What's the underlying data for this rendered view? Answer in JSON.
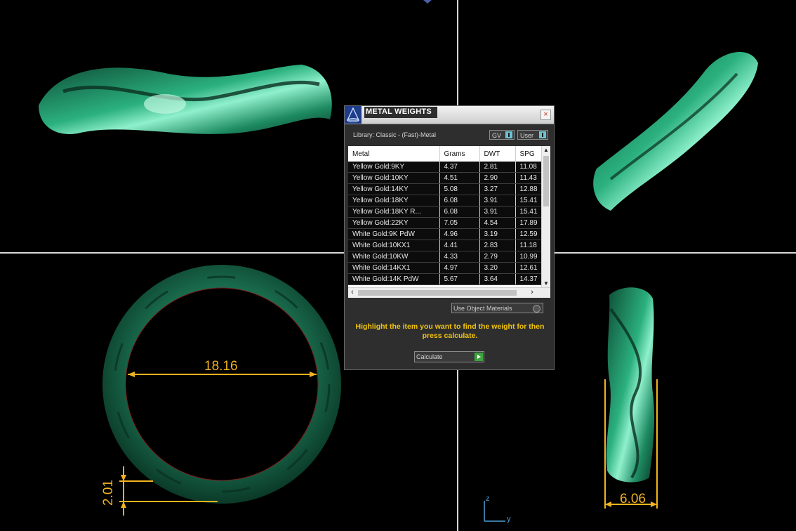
{
  "dialog": {
    "title": "METAL WEIGHTS",
    "close_symbol": "×",
    "library": "Library: Classic - (Fast)-Metal",
    "toggles": {
      "gv": "GV",
      "user": "User"
    },
    "table": {
      "headers": [
        "Metal",
        "Grams",
        "DWT",
        "SPG"
      ],
      "rows": [
        [
          "Yellow Gold:9KY",
          "4.37",
          "2.81",
          "11.08"
        ],
        [
          "Yellow Gold:10KY",
          "4.51",
          "2.90",
          "11.43"
        ],
        [
          "Yellow Gold:14KY",
          "5.08",
          "3.27",
          "12.88"
        ],
        [
          "Yellow Gold:18KY",
          "6.08",
          "3.91",
          "15.41"
        ],
        [
          "Yellow Gold:18KY R...",
          "6.08",
          "3.91",
          "15.41"
        ],
        [
          "Yellow Gold:22KY",
          "7.05",
          "4.54",
          "17.89"
        ],
        [
          "White Gold:9K PdW",
          "4.96",
          "3.19",
          "12.59"
        ],
        [
          "White Gold:10KX1",
          "4.41",
          "2.83",
          "11.18"
        ],
        [
          "White Gold:10KW",
          "4.33",
          "2.79",
          "10.99"
        ],
        [
          "White Gold:14KX1",
          "4.97",
          "3.20",
          "12.61"
        ],
        [
          "White Gold:14K PdW",
          "5.67",
          "3.64",
          "14.37"
        ]
      ]
    },
    "use_object_materials": "Use Object Materials",
    "hint": "Highlight the item you want to find the weight for then press calculate.",
    "calculate": "Calculate"
  },
  "dimensions": {
    "inner_diameter": "18.16",
    "band_thickness": "2.01",
    "band_width": "6.06"
  },
  "axes": {
    "z": "z",
    "y": "y"
  },
  "colors": {
    "ring": "#1f8a63",
    "dimension": "#f3b31f",
    "hint": "#f2c40f",
    "axis": "#4a9fd6"
  }
}
